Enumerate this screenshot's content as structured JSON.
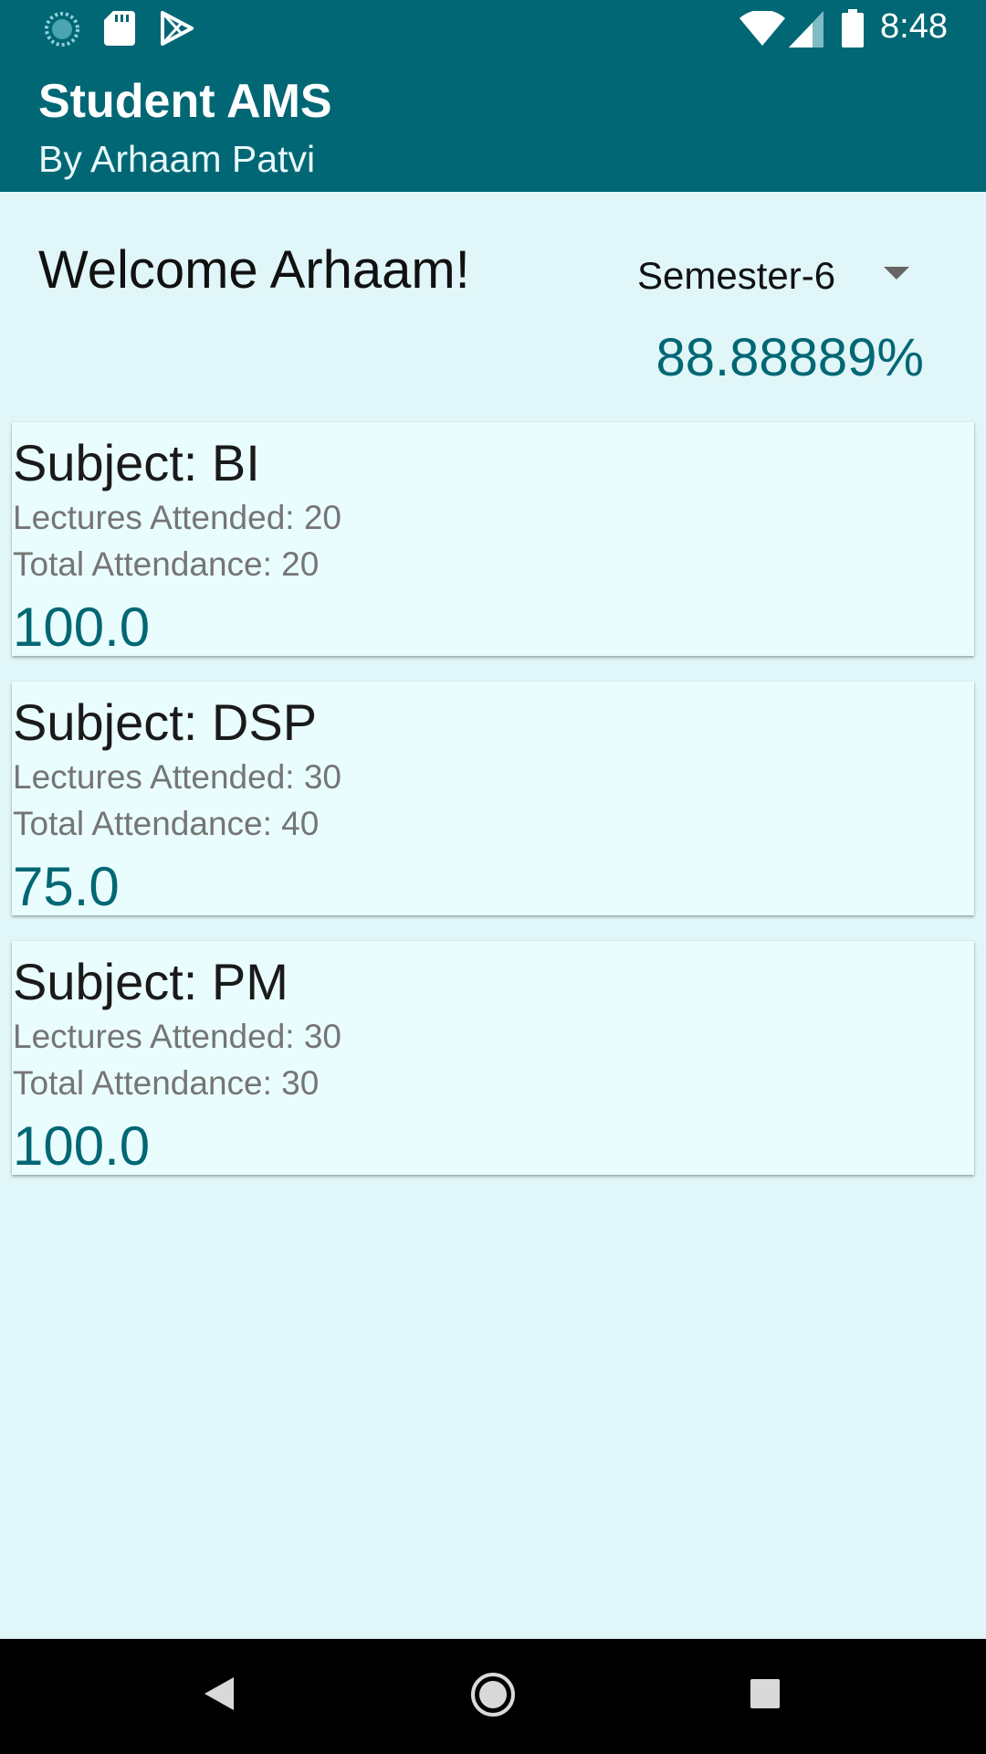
{
  "status_bar": {
    "time": "8:48",
    "left_icons": [
      "loading-icon",
      "sd-card-icon",
      "play-store-icon"
    ],
    "right_icons": [
      "wifi-icon",
      "signal-icon",
      "battery-icon"
    ]
  },
  "app_bar": {
    "title": "Student AMS",
    "subtitle": "By Arhaam Patvi"
  },
  "header": {
    "welcome": "Welcome Arhaam!",
    "semester_selected": "Semester-6",
    "overall_percentage": "88.88889%"
  },
  "subjects": [
    {
      "subject": "Subject: BI",
      "lectures_attended": "Lectures Attended: 20",
      "total_attendance": "Total Attendance: 20",
      "percentage": "100.0"
    },
    {
      "subject": "Subject: DSP",
      "lectures_attended": "Lectures Attended: 30",
      "total_attendance": "Total Attendance: 40",
      "percentage": "75.0"
    },
    {
      "subject": "Subject: PM",
      "lectures_attended": "Lectures Attended: 30",
      "total_attendance": "Total Attendance: 30",
      "percentage": "100.0"
    }
  ],
  "nav_bar": {
    "buttons": [
      "back-icon",
      "home-icon",
      "recents-icon"
    ]
  },
  "colors": {
    "primary": "#016775",
    "background": "#e0f6f8",
    "card": "#eafdfe",
    "accent_text": "#016775"
  }
}
